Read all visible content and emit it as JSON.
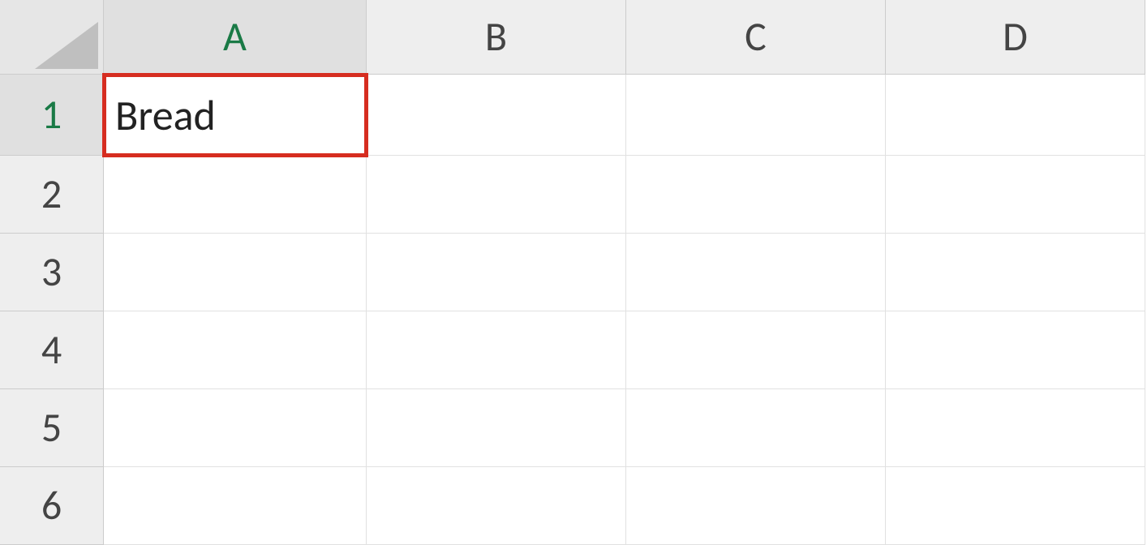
{
  "spreadsheet": {
    "columns": [
      "A",
      "B",
      "C",
      "D"
    ],
    "rows": [
      "1",
      "2",
      "3",
      "4",
      "5",
      "6"
    ],
    "activeColumn": "A",
    "activeRow": "1",
    "highlightedCell": "A1",
    "cells": {
      "A1": "Bread",
      "B1": "",
      "C1": "",
      "D1": "",
      "A2": "",
      "B2": "",
      "C2": "",
      "D2": "",
      "A3": "",
      "B3": "",
      "C3": "",
      "D3": "",
      "A4": "",
      "B4": "",
      "C4": "",
      "D4": "",
      "A5": "",
      "B5": "",
      "C5": "",
      "D5": "",
      "A6": "",
      "B6": "",
      "C6": "",
      "D6": ""
    }
  }
}
